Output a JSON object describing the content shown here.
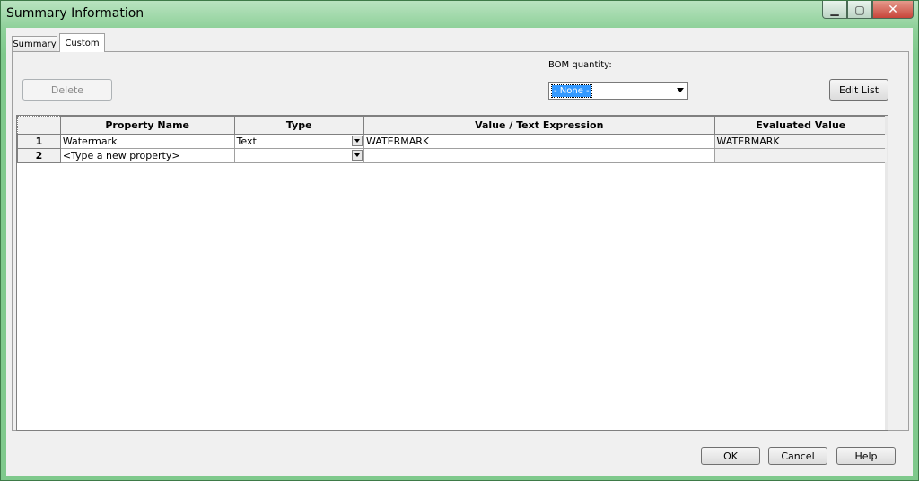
{
  "window": {
    "title": "Summary Information"
  },
  "tabs": [
    {
      "label": "Summary"
    },
    {
      "label": "Custom"
    }
  ],
  "toolbar": {
    "delete_label": "Delete",
    "edit_list_label": "Edit List"
  },
  "bom": {
    "label": "BOM quantity:",
    "value": "- None -"
  },
  "grid": {
    "headers": [
      "",
      "Property Name",
      "Type",
      "Value / Text Expression",
      "Evaluated Value"
    ],
    "rows": [
      {
        "num": "1",
        "name": "Watermark",
        "type": "Text",
        "value": "WATERMARK",
        "evaluated": "WATERMARK"
      },
      {
        "num": "2",
        "name": "<Type a new property>",
        "type": "",
        "value": "",
        "evaluated": ""
      }
    ]
  },
  "footer": {
    "ok_label": "OK",
    "cancel_label": "Cancel",
    "help_label": "Help"
  }
}
